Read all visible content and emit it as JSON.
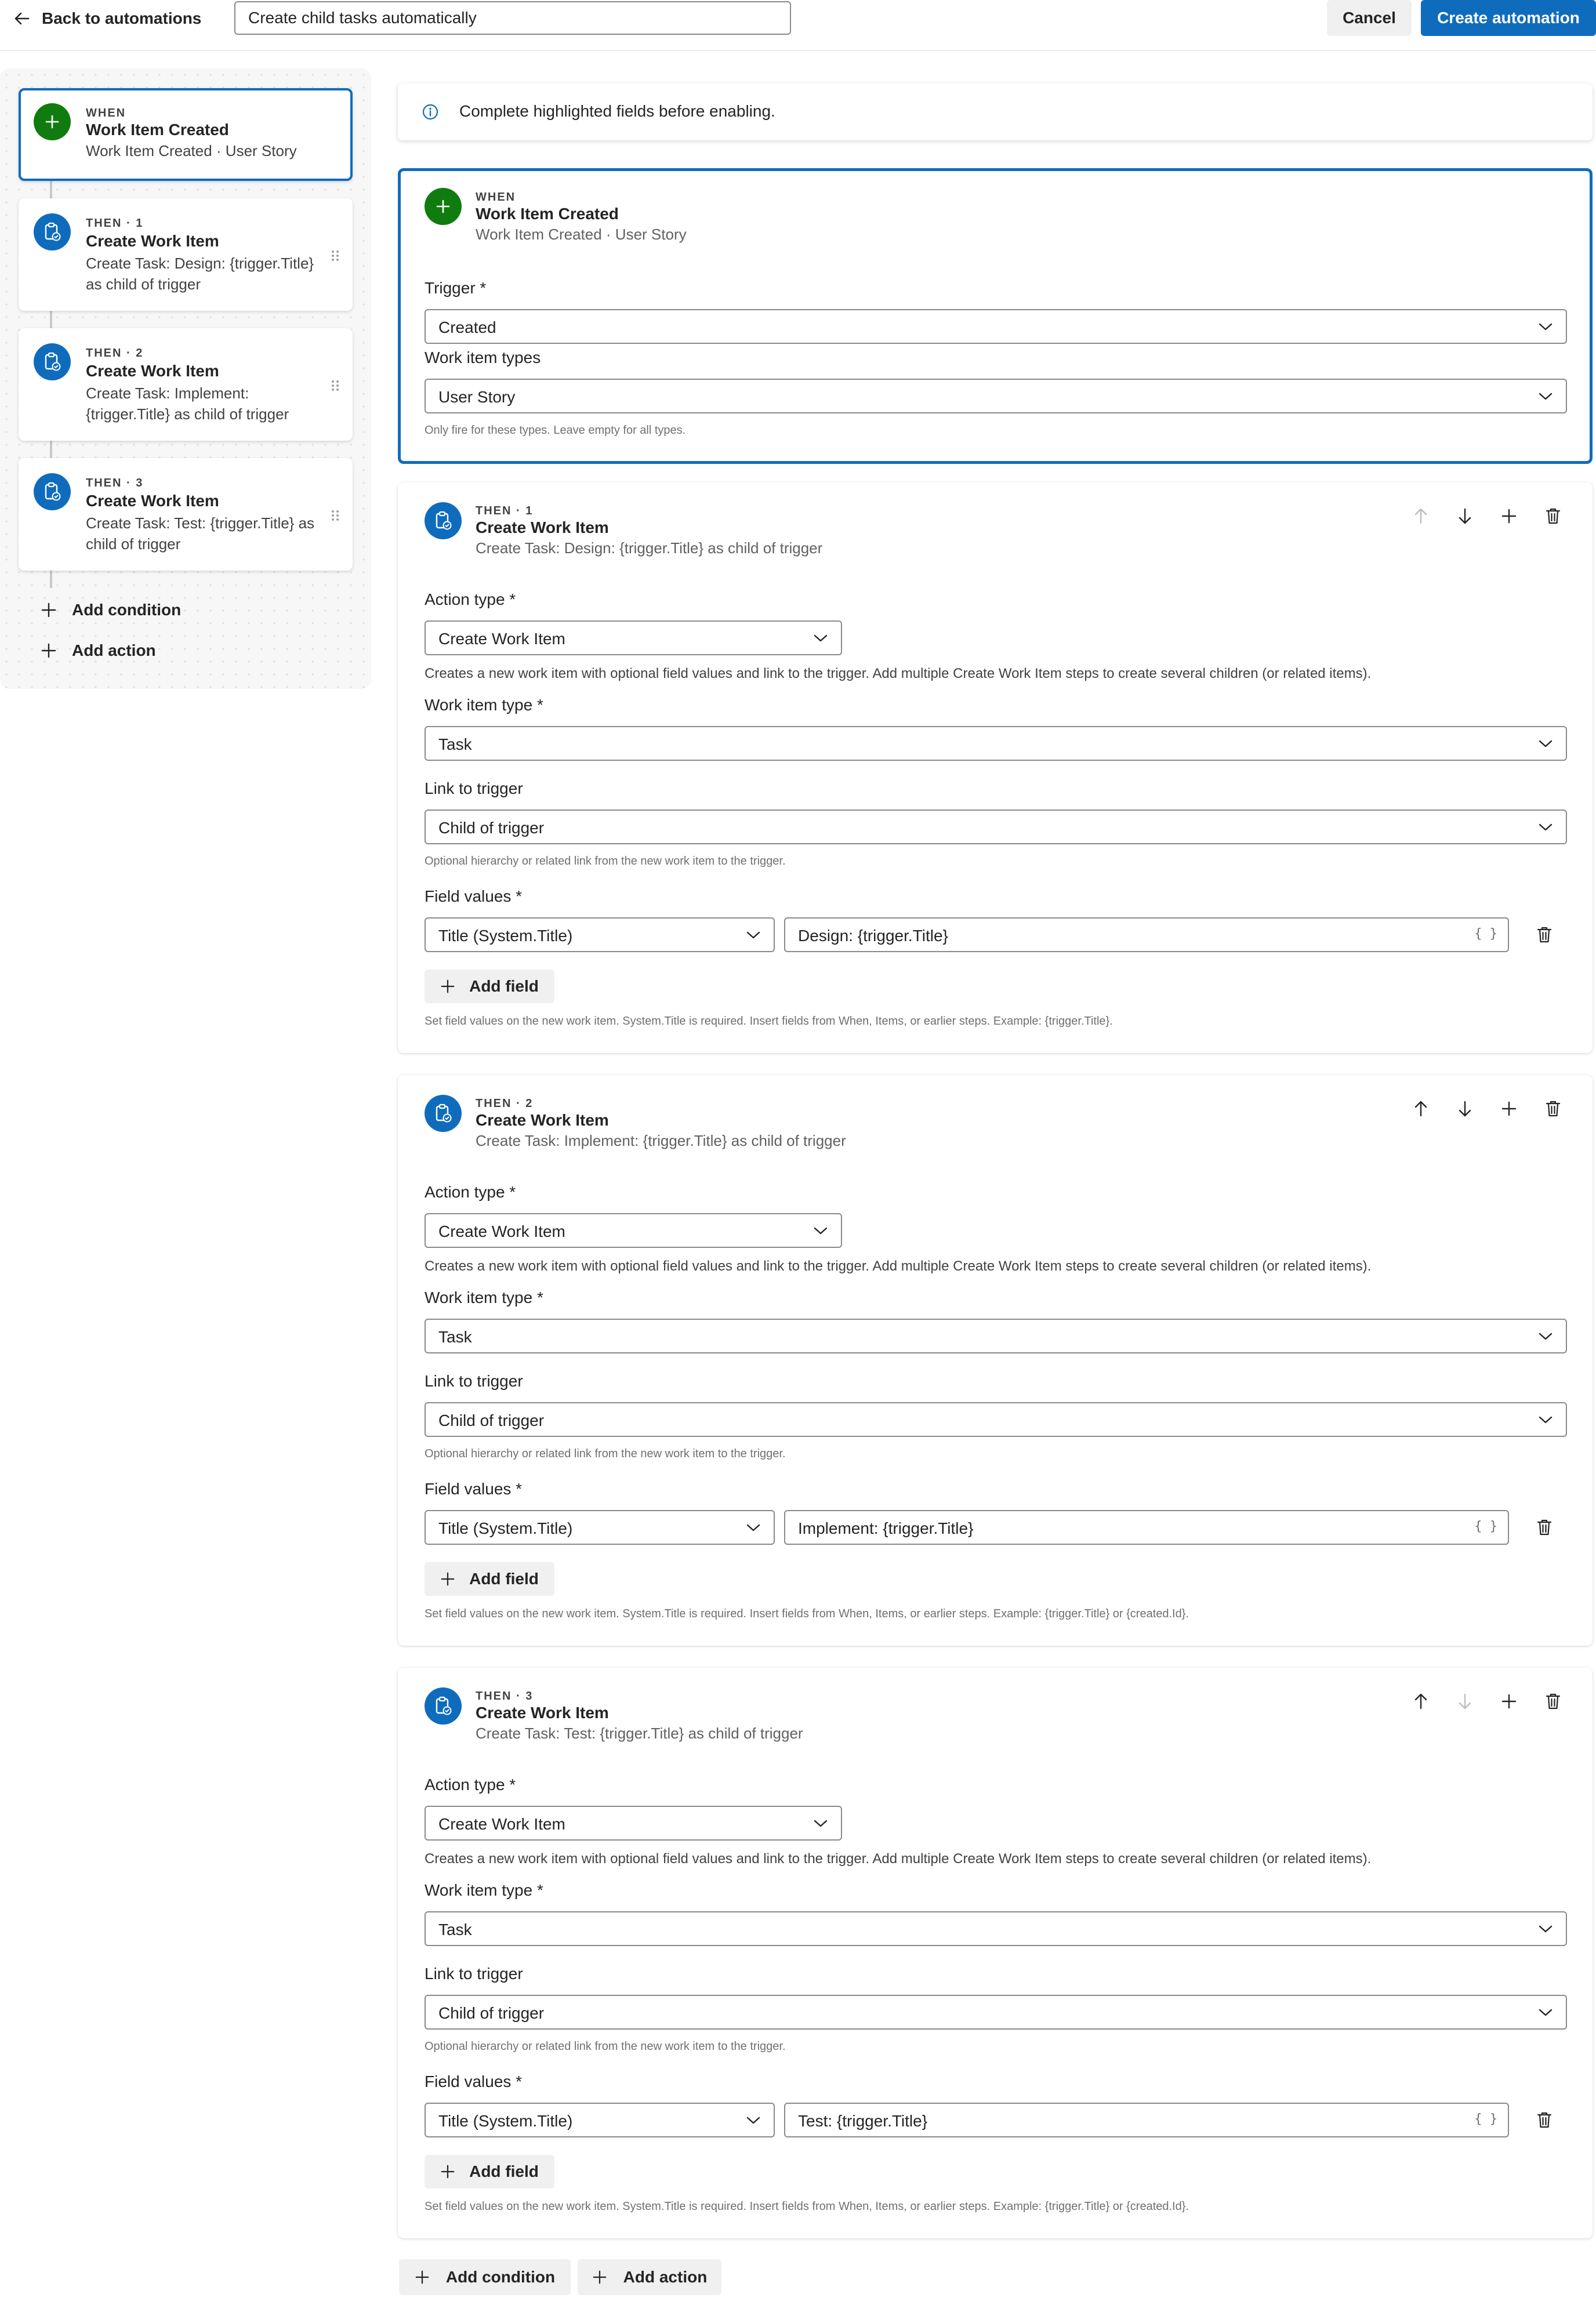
{
  "header": {
    "back_label": "Back to automations",
    "title_value": "Create child tasks automatically",
    "cancel_label": "Cancel",
    "create_label": "Create automation"
  },
  "sidebar": {
    "when_card": {
      "kicker": "WHEN",
      "name": "Work Item Created",
      "desc": "Work Item Created · User Story"
    },
    "then_cards": [
      {
        "kicker": "THEN · 1",
        "name": "Create Work Item",
        "desc": "Create Task: Design: {trigger.Title} as child of trigger"
      },
      {
        "kicker": "THEN · 2",
        "name": "Create Work Item",
        "desc": "Create Task: Implement: {trigger.Title} as child of trigger"
      },
      {
        "kicker": "THEN · 3",
        "name": "Create Work Item",
        "desc": "Create Task: Test: {trigger.Title} as child of trigger"
      }
    ],
    "add_condition_label": "Add condition",
    "add_action_label": "Add action"
  },
  "banner": {
    "text": "Complete highlighted fields before enabling."
  },
  "trigger_card": {
    "kicker": "WHEN",
    "name": "Work Item Created",
    "sub": "Work Item Created · User Story",
    "trigger_label": "Trigger *",
    "trigger_value": "Created",
    "types_label": "Work item types",
    "types_value": "User Story",
    "types_hint": "Only fire for these types. Leave empty for all types."
  },
  "actions": [
    {
      "kicker": "THEN · 1",
      "name": "Create Work Item",
      "sub": "Create Task: Design: {trigger.Title} as child of trigger",
      "action_type_label": "Action type *",
      "action_type_value": "Create Work Item",
      "action_desc": "Creates a new work item with optional field values and link to the trigger. Add multiple Create Work Item steps to create several children (or related items).",
      "wit_label": "Work item type *",
      "wit_value": "Task",
      "link_label": "Link to trigger",
      "link_value": "Child of trigger",
      "link_hint": "Optional hierarchy or related link from the new work item to the trigger.",
      "fields_label": "Field values *",
      "field_name": "Title (System.Title)",
      "field_value": "Design: {trigger.Title}",
      "brace": "{ }",
      "add_field_label": "Add field",
      "fields_hint": "Set field values on the new work item. System.Title is required. Insert fields from When, Items, or earlier steps. Example: {trigger.Title}."
    },
    {
      "kicker": "THEN · 2",
      "name": "Create Work Item",
      "sub": "Create Task: Implement: {trigger.Title} as child of trigger",
      "action_type_label": "Action type *",
      "action_type_value": "Create Work Item",
      "action_desc": "Creates a new work item with optional field values and link to the trigger. Add multiple Create Work Item steps to create several children (or related items).",
      "wit_label": "Work item type *",
      "wit_value": "Task",
      "link_label": "Link to trigger",
      "link_value": "Child of trigger",
      "link_hint": "Optional hierarchy or related link from the new work item to the trigger.",
      "fields_label": "Field values *",
      "field_name": "Title (System.Title)",
      "field_value": "Implement: {trigger.Title}",
      "brace": "{ }",
      "add_field_label": "Add field",
      "fields_hint": "Set field values on the new work item. System.Title is required. Insert fields from When, Items, or earlier steps. Example: {trigger.Title} or {created.Id}."
    },
    {
      "kicker": "THEN · 3",
      "name": "Create Work Item",
      "sub": "Create Task: Test: {trigger.Title} as child of trigger",
      "action_type_label": "Action type *",
      "action_type_value": "Create Work Item",
      "action_desc": "Creates a new work item with optional field values and link to the trigger. Add multiple Create Work Item steps to create several children (or related items).",
      "wit_label": "Work item type *",
      "wit_value": "Task",
      "link_label": "Link to trigger",
      "link_value": "Child of trigger",
      "link_hint": "Optional hierarchy or related link from the new work item to the trigger.",
      "fields_label": "Field values *",
      "field_name": "Title (System.Title)",
      "field_value": "Test: {trigger.Title}",
      "brace": "{ }",
      "add_field_label": "Add field",
      "fields_hint": "Set field values on the new work item. System.Title is required. Insert fields from When, Items, or earlier steps. Example: {trigger.Title} or {created.Id}."
    }
  ],
  "bottom": {
    "add_condition_label": "Add condition",
    "add_action_label": "Add action"
  },
  "colors": {
    "accent": "#0f6cbd",
    "success": "#107c10",
    "text": "#242424",
    "muted": "#616161",
    "border": "#8a8a8a"
  },
  "icons": [
    "arrow-left-icon",
    "plus-icon",
    "clipboard-task-icon",
    "info-icon",
    "chevron-down-icon",
    "arrow-up-icon",
    "arrow-down-icon",
    "trash-icon",
    "drag-handle-icon"
  ]
}
